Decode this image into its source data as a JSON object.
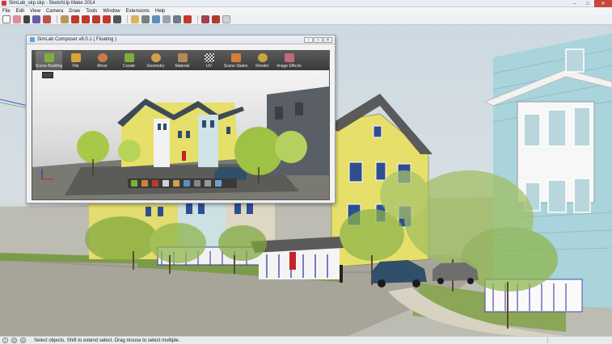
{
  "window": {
    "title": "SimLab_skp.skp - SketchUp Make 2014",
    "minimize": "–",
    "maximize": "□",
    "close": "✕"
  },
  "menu": [
    "File",
    "Edit",
    "View",
    "Camera",
    "Draw",
    "Tools",
    "Window",
    "Extensions",
    "Help"
  ],
  "toolbar": {
    "icons": [
      "select-icon",
      "eraser-icon",
      "pencil-icon",
      "arc-icon",
      "shape-icon",
      "push-pull-icon",
      "move-icon",
      "rotate-icon",
      "scale-icon",
      "offset-icon",
      "tape-measure-icon",
      "text-icon",
      "paint-bucket-icon",
      "orbit-icon",
      "pan-icon",
      "zoom-icon",
      "zoom-extents-icon",
      "warehouse-icon",
      "extension-icon",
      "layout-icon"
    ]
  },
  "composer": {
    "title": "SimLab Composer v8.0.1 ( Floating )",
    "ribbon": [
      {
        "label": "Scene Building",
        "color": "#7fae3a"
      },
      {
        "label": "File",
        "color": "#d9a43a"
      },
      {
        "label": "Move",
        "color": "#c77d4a"
      },
      {
        "label": "Create",
        "color": "#7fae3a"
      },
      {
        "label": "Geometry",
        "color": "#d0a04a"
      },
      {
        "label": "Material",
        "color": "#b38a5a"
      },
      {
        "label": "UV",
        "color": "#8a8a8a"
      },
      {
        "label": "Scene States",
        "color": "#d27f3a"
      },
      {
        "label": "Render",
        "color": "#c9a63a"
      },
      {
        "label": "Image Effects",
        "color": "#c06a7a"
      }
    ]
  },
  "status": {
    "message": "Select objects. Shift to extend select. Drag mouse to select multiple.",
    "icons": [
      "info-icon",
      "geo-icon",
      "user-icon"
    ]
  },
  "colors": {
    "house_yellow": "#e6df6a",
    "house_blue": "#a9d4dc",
    "house_dark": "#5a5f66",
    "tree_green": "#7fa83e"
  }
}
